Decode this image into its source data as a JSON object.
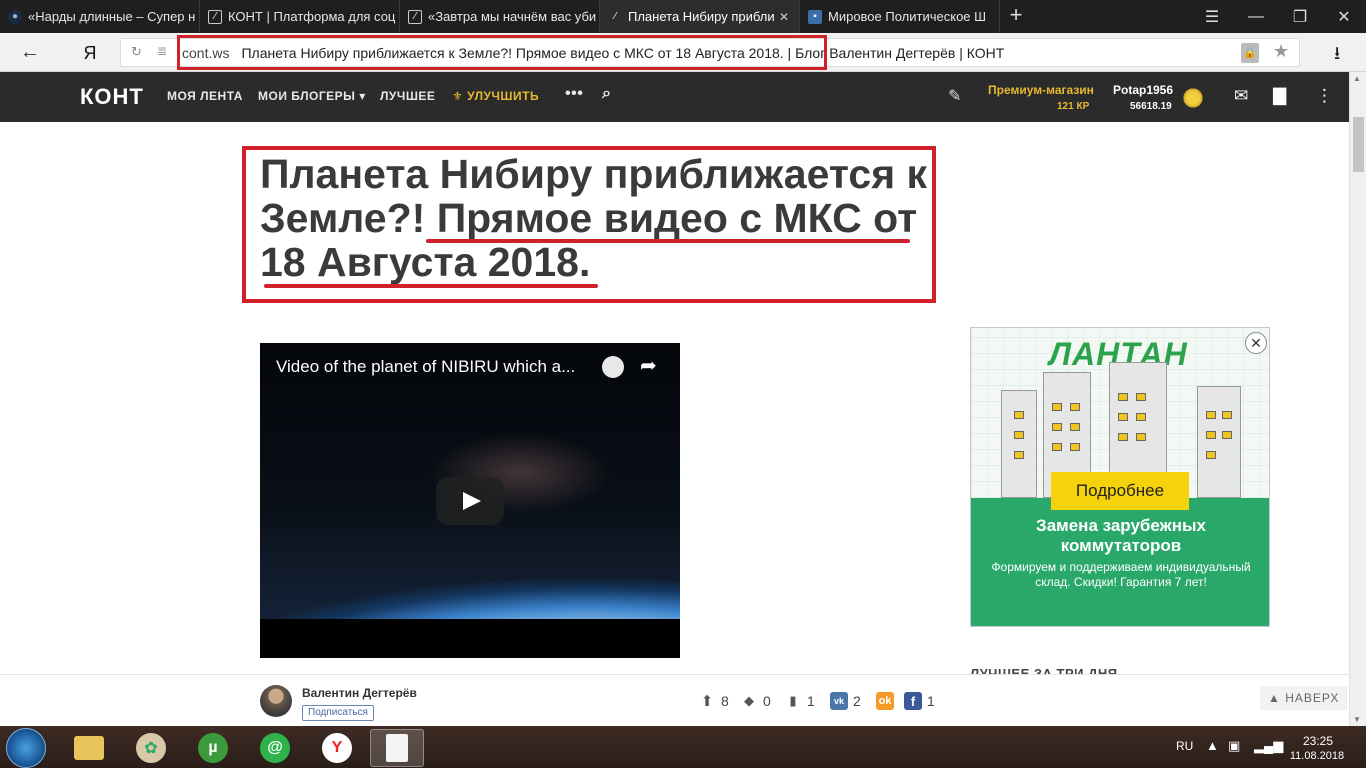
{
  "browser": {
    "tabs": [
      {
        "title": "«Нарды длинные – Супер н",
        "favicon": "nardy-icon",
        "active": false
      },
      {
        "title": "КОНТ | Платформа для соц",
        "favicon": "kont-icon",
        "active": false
      },
      {
        "title": "«Завтра мы начнём вас уби",
        "favicon": "kont-icon",
        "active": false
      },
      {
        "title": "Планета Нибиру прибли",
        "favicon": "kont-icon",
        "active": true
      },
      {
        "title": "Мировое Политическое Ш",
        "favicon": "site-icon",
        "active": false
      }
    ],
    "address": {
      "host": "cont.ws",
      "page_title": "Планета Нибиру приближается к Земле?! Прямое видео с МКС от 18 Августа 2018. | Блог Валентин Дегтерёв | КОНТ"
    },
    "search_logo": "Я",
    "accent_color": "#d0202a"
  },
  "site": {
    "logo": "КОНТ",
    "nav": [
      {
        "label": "МОЯ ЛЕНТА"
      },
      {
        "label": "МОИ БЛОГЕРЫ ▾"
      },
      {
        "label": "ЛУЧШЕЕ"
      },
      {
        "label": "УЛУЧШИТЬ"
      }
    ],
    "shop": {
      "label": "Премиум-магазин",
      "kp": "121 КР"
    },
    "user": {
      "name": "Potap1956",
      "score": "56618.19"
    },
    "gold_color": "#e7b830"
  },
  "article": {
    "title_part1": "Планета Нибиру приближается к Земле?! ",
    "title_part2": "Прямое видео с МКС от 18 Августа 2018.",
    "video": {
      "title": "Video of the planet of NIBIRU which a..."
    }
  },
  "ad": {
    "brand": "ЛАНТАН",
    "button": "Подробнее",
    "headline": "Замена зарубежных коммутаторов",
    "sub": "Формируем и поддерживаем индивидуальный склад. Скидки! Гарантия 7 лет!"
  },
  "sidebar": {
    "best_label": "ЛУЧШЕЕ ЗА ТРИ ДНЯ"
  },
  "footer": {
    "author": "Валентин Дегтерёв",
    "subscribe": "Подписаться",
    "stats": {
      "up": "8",
      "turtle": "0",
      "bookmark": "1",
      "vk": "2",
      "ok": "",
      "fb": "1"
    },
    "back_to_top": "НАВЕРХ"
  },
  "taskbar": {
    "lang": "RU",
    "time": "23:25",
    "date": "11.08.2018"
  }
}
